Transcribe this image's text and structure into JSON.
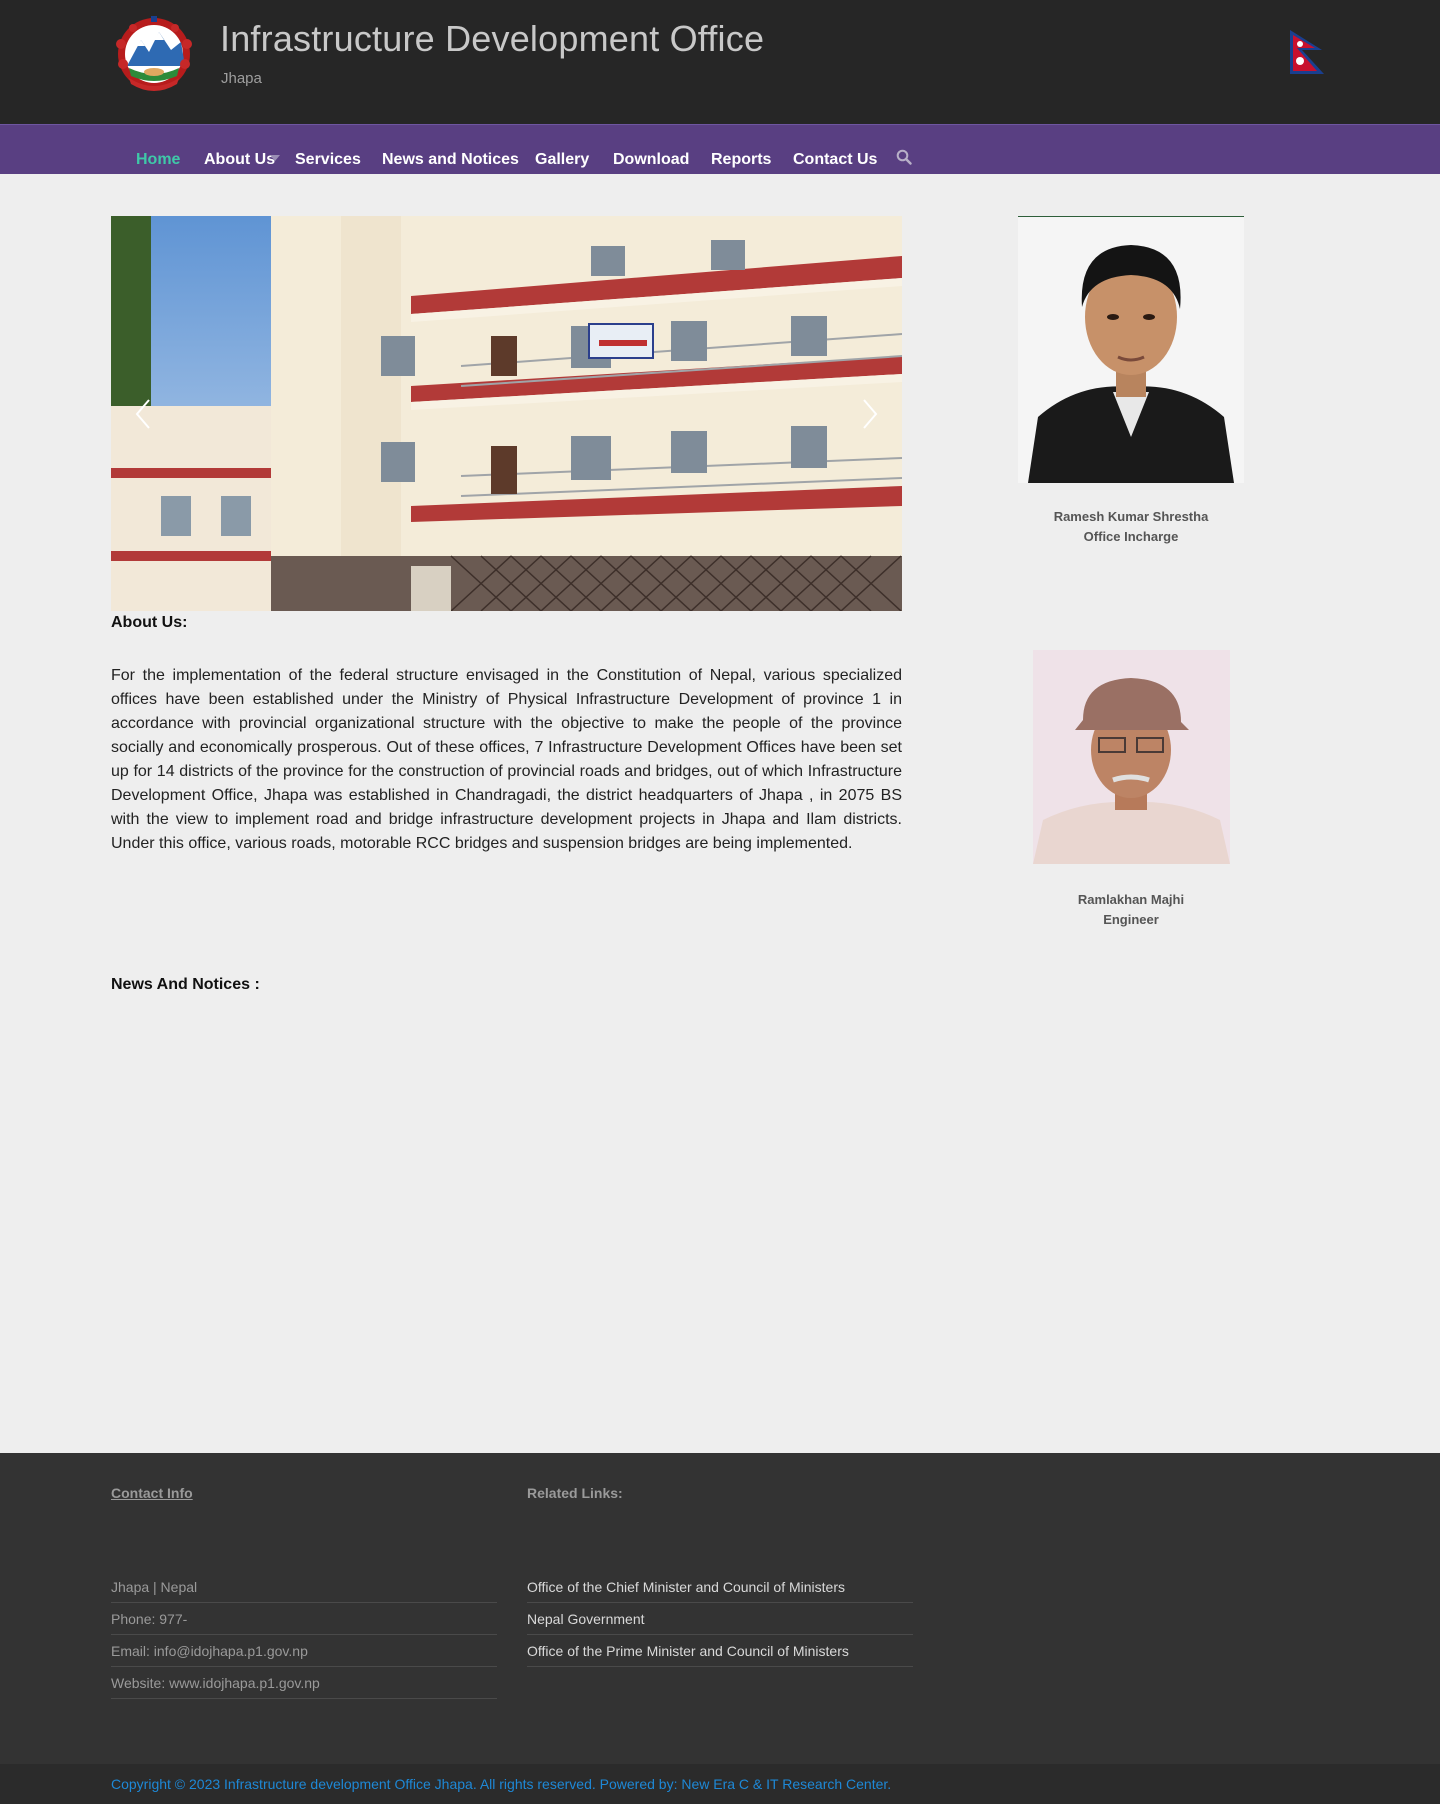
{
  "header": {
    "title": "Infrastructure Development Office",
    "subtitle": "Jhapa"
  },
  "nav": {
    "items": [
      {
        "label": "Home",
        "active": true
      },
      {
        "label": "About Us"
      },
      {
        "label": "Services"
      },
      {
        "label": "News and Notices"
      },
      {
        "label": "Gallery"
      },
      {
        "label": "Download"
      },
      {
        "label": "Reports"
      },
      {
        "label": "Contact Us"
      }
    ],
    "search_icon": "search-icon",
    "active_color": "#3fc8a8",
    "bar_color": "#593f82"
  },
  "slider": {
    "prev_icon": "chevron-left-icon",
    "next_icon": "chevron-right-icon"
  },
  "about": {
    "heading": "About Us:",
    "text": "For the implementation of the federal structure envisaged in the Constitution of Nepal, various specialized offices have been established under the Ministry of Physical Infrastructure Development of province 1 in accordance with provincial organizational structure with the objective to make the people of the province socially and economically prosperous. Out of these offices, 7 Infrastructure Development Offices have been set up for 14 districts of the province for the construction of provincial roads and bridges, out of which Infrastructure Development Office, Jhapa was established in Chandragadi, the district headquarters of Jhapa , in 2075 BS with the view to implement road and bridge infrastructure development projects in Jhapa and Ilam districts. Under this office, various roads, motorable RCC bridges and suspension bridges are being implemented."
  },
  "news": {
    "heading": "News And Notices :"
  },
  "staff": [
    {
      "name": "Ramesh Kumar Shrestha",
      "role": "Office Incharge"
    },
    {
      "name": "Ramlakhan Majhi",
      "role": "Engineer"
    }
  ],
  "footer": {
    "contact_heading": "Contact Info",
    "contact_lines": [
      "Jhapa | Nepal",
      "Phone: 977-",
      "Email: info@idojhapa.p1.gov.np",
      "Website: www.idojhapa.p1.gov.np"
    ],
    "links_heading": "Related Links:",
    "links": [
      "Office of the Chief Minister and Council of Ministers",
      "Nepal Government",
      "Office of the Prime Minister and Council of Ministers"
    ],
    "copyright": "Copyright © 2023 Infrastructure development Office Jhapa. All rights reserved. Powered by: New Era C & IT Research Center.",
    "copyright_color": "#1e88d6"
  }
}
